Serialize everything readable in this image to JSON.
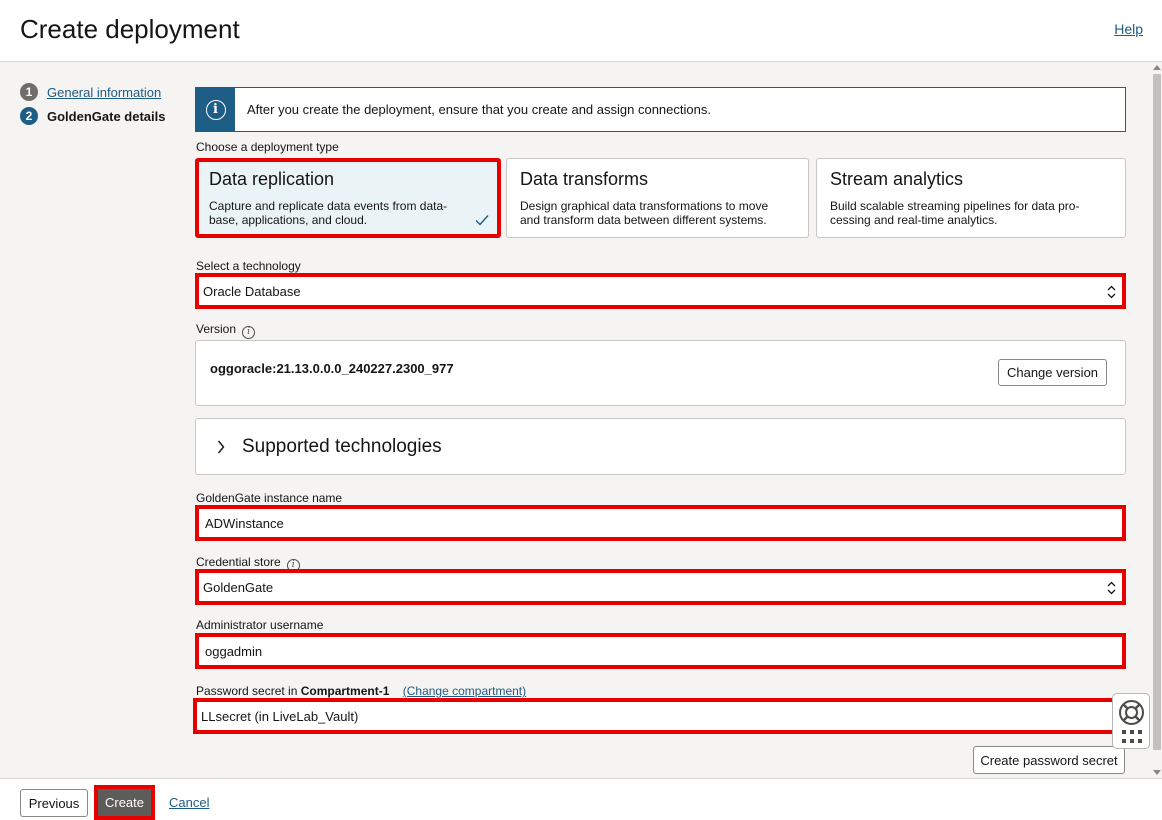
{
  "header": {
    "title": "Create deployment",
    "help_label": "Help"
  },
  "steps": [
    {
      "number": "1",
      "label": "General information"
    },
    {
      "number": "2",
      "label": "GoldenGate details"
    }
  ],
  "info_banner": {
    "message": "After you create the deployment, ensure that you create and assign connections."
  },
  "deployment_type": {
    "label": "Choose a deployment type",
    "options": [
      {
        "title": "Data replication",
        "desc1": "Capture and replicate data events from data-",
        "desc2": "base, applications, and cloud.",
        "selected": true
      },
      {
        "title": "Data transforms",
        "desc1": "Design graphical data transformations to move",
        "desc2": "and transform data between different systems.",
        "selected": false
      },
      {
        "title": "Stream analytics",
        "desc1": "Build scalable streaming pipelines for data pro-",
        "desc2": "cessing and real-time analytics.",
        "selected": false
      }
    ]
  },
  "technology": {
    "label": "Select a technology",
    "value": "Oracle Database"
  },
  "version": {
    "label": "Version",
    "value": "oggoracle:21.13.0.0.0_240227.2300_977",
    "change_label": "Change version"
  },
  "supported_technologies": {
    "title": "Supported technologies"
  },
  "instance_name": {
    "label": "GoldenGate instance name",
    "value": "ADWinstance"
  },
  "credential_store": {
    "label": "Credential store",
    "value": "GoldenGate"
  },
  "admin_username": {
    "label": "Administrator username",
    "value": "oggadmin"
  },
  "password_secret": {
    "label_prefix": "Password secret in",
    "compartment": "Compartment-1",
    "change_compartment": "(Change compartment)",
    "value": "LLsecret (in LiveLab_Vault)",
    "create_label": "Create password secret"
  },
  "footer": {
    "previous_label": "Previous",
    "create_label": "Create",
    "cancel_label": "Cancel"
  },
  "colors": {
    "accent": "#1e5d86",
    "highlight": "#e60000",
    "link": "#1f5b85"
  },
  "icons": [
    "info-icon",
    "checkmark-icon",
    "chevron-right-icon",
    "select-arrows-icon",
    "life-ring-icon",
    "grid-icon"
  ]
}
